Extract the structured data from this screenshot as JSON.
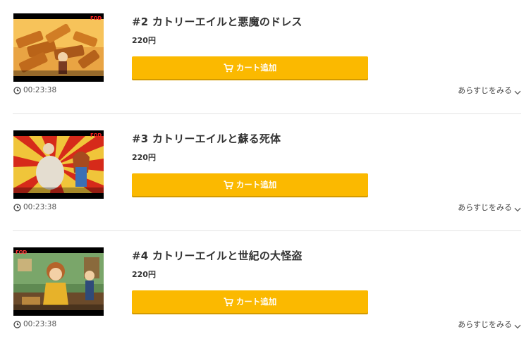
{
  "episodes": [
    {
      "title": "#2 カトリーエイルと悪魔のドレス",
      "price": "220円",
      "cart_label": "カート追加",
      "duration": "00:23:38",
      "synopsis_label": "あらすじをみる",
      "thumbnail_logo": "FOD"
    },
    {
      "title": "#3 カトリーエイルと蘇る死体",
      "price": "220円",
      "cart_label": "カート追加",
      "duration": "00:23:38",
      "synopsis_label": "あらすじをみる",
      "thumbnail_logo": "FOD"
    },
    {
      "title": "#4 カトリーエイルと世紀の大怪盗",
      "price": "220円",
      "cart_label": "カート追加",
      "duration": "00:23:38",
      "synopsis_label": "あらすじをみる",
      "thumbnail_logo": "FOD"
    }
  ],
  "colors": {
    "cart_button": "#fbb900",
    "divider": "#e3e3e3",
    "text": "#333333"
  },
  "icons": {
    "clock": "clock-icon",
    "cart": "cart-icon",
    "chevron": "chevron-down-icon"
  }
}
